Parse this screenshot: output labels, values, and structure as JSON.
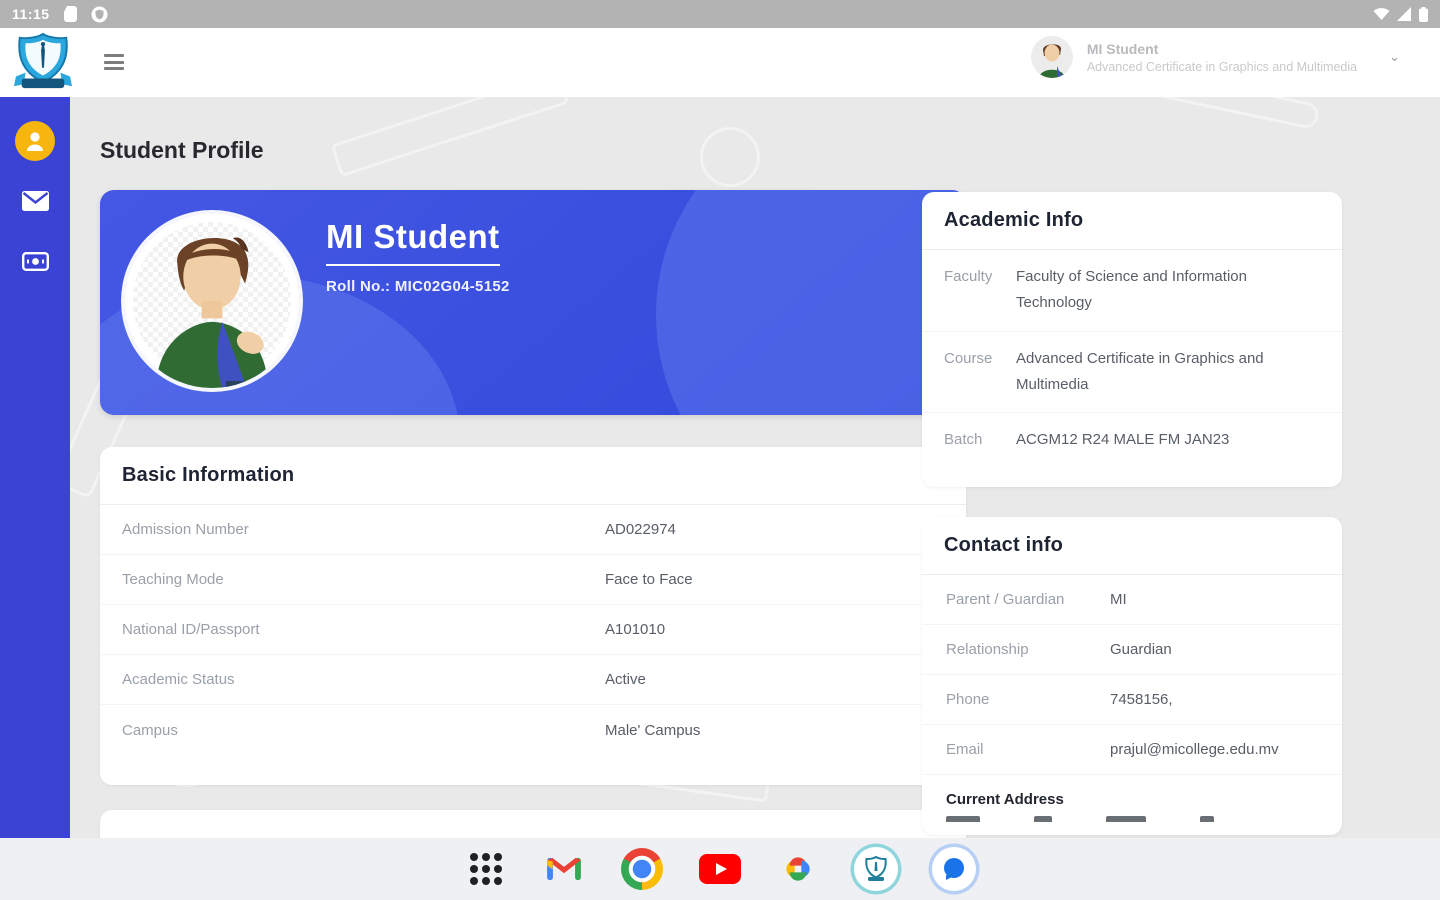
{
  "status_bar": {
    "time": "11:15",
    "left_icons": [
      "battery-app-icon",
      "shield-circle-icon"
    ],
    "right_icons": [
      "wifi-icon",
      "signal-icon",
      "battery-icon"
    ]
  },
  "header": {
    "user_name": "MI Student",
    "user_course": "Advanced Certificate in Graphics and Multimedia"
  },
  "sidebar": {
    "items": [
      {
        "name": "profile",
        "icon": "person-icon",
        "active": true
      },
      {
        "name": "messages",
        "icon": "envelope-icon",
        "active": false
      },
      {
        "name": "payments",
        "icon": "banknote-icon",
        "active": false
      }
    ]
  },
  "page": {
    "title": "Student Profile"
  },
  "profile_card": {
    "name": "MI Student",
    "roll_no": "Roll No.: MIC02G04-5152"
  },
  "basic_info": {
    "title": "Basic Information",
    "rows": [
      {
        "label": "Admission Number",
        "value": "AD022974"
      },
      {
        "label": "Teaching Mode",
        "value": "Face to Face"
      },
      {
        "label": "National ID/Passport",
        "value": "A101010"
      },
      {
        "label": "Academic Status",
        "value": "Active"
      },
      {
        "label": "Campus",
        "value": "Male' Campus"
      }
    ]
  },
  "academic_info": {
    "title": "Academic Info",
    "rows": [
      {
        "label": "Faculty",
        "value": "Faculty of Science and Information Technology"
      },
      {
        "label": "Course",
        "value": "Advanced Certificate in Graphics and Multimedia"
      },
      {
        "label": "Batch",
        "value": "ACGM12 R24 MALE FM JAN23"
      }
    ]
  },
  "contact_info": {
    "title": "Contact info",
    "rows": [
      {
        "label": "Parent / Guardian",
        "value": "MI"
      },
      {
        "label": "Relationship",
        "value": "Guardian"
      },
      {
        "label": "Phone",
        "value": "7458156,"
      },
      {
        "label": "Email",
        "value": "prajul@micollege.edu.mv"
      }
    ],
    "current_address_label": "Current Address"
  },
  "taskbar": {
    "apps": [
      "app-drawer",
      "gmail",
      "chrome",
      "youtube",
      "google-photos",
      "mi-college-app",
      "google-messages"
    ]
  },
  "colors": {
    "sidebar_blue": "#3b43d5",
    "active_yellow": "#f6b60d",
    "card_blue": "#3347da",
    "heading_dark": "#1e2433",
    "label_gray": "#9aa0a8",
    "value_gray": "#585e66"
  }
}
